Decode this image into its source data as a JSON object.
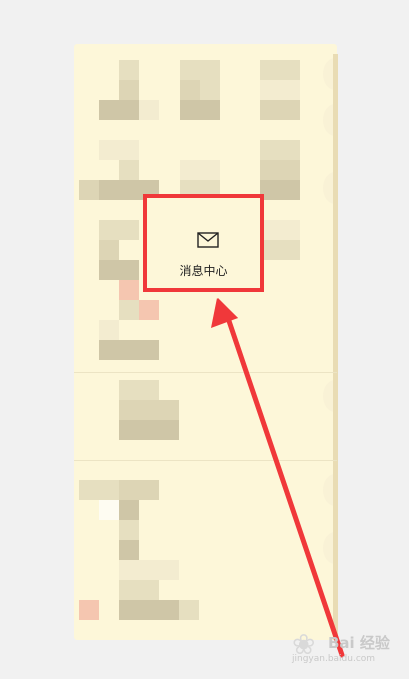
{
  "message_center": {
    "label": "消息中心",
    "icon": "envelope-icon"
  },
  "watermark": {
    "brand": "Bai 经验",
    "url": "jingyan.baidu.com"
  },
  "colors": {
    "annotation": "#f0383a",
    "panel": "#fdf7d9",
    "background": "#f1f1f1"
  }
}
